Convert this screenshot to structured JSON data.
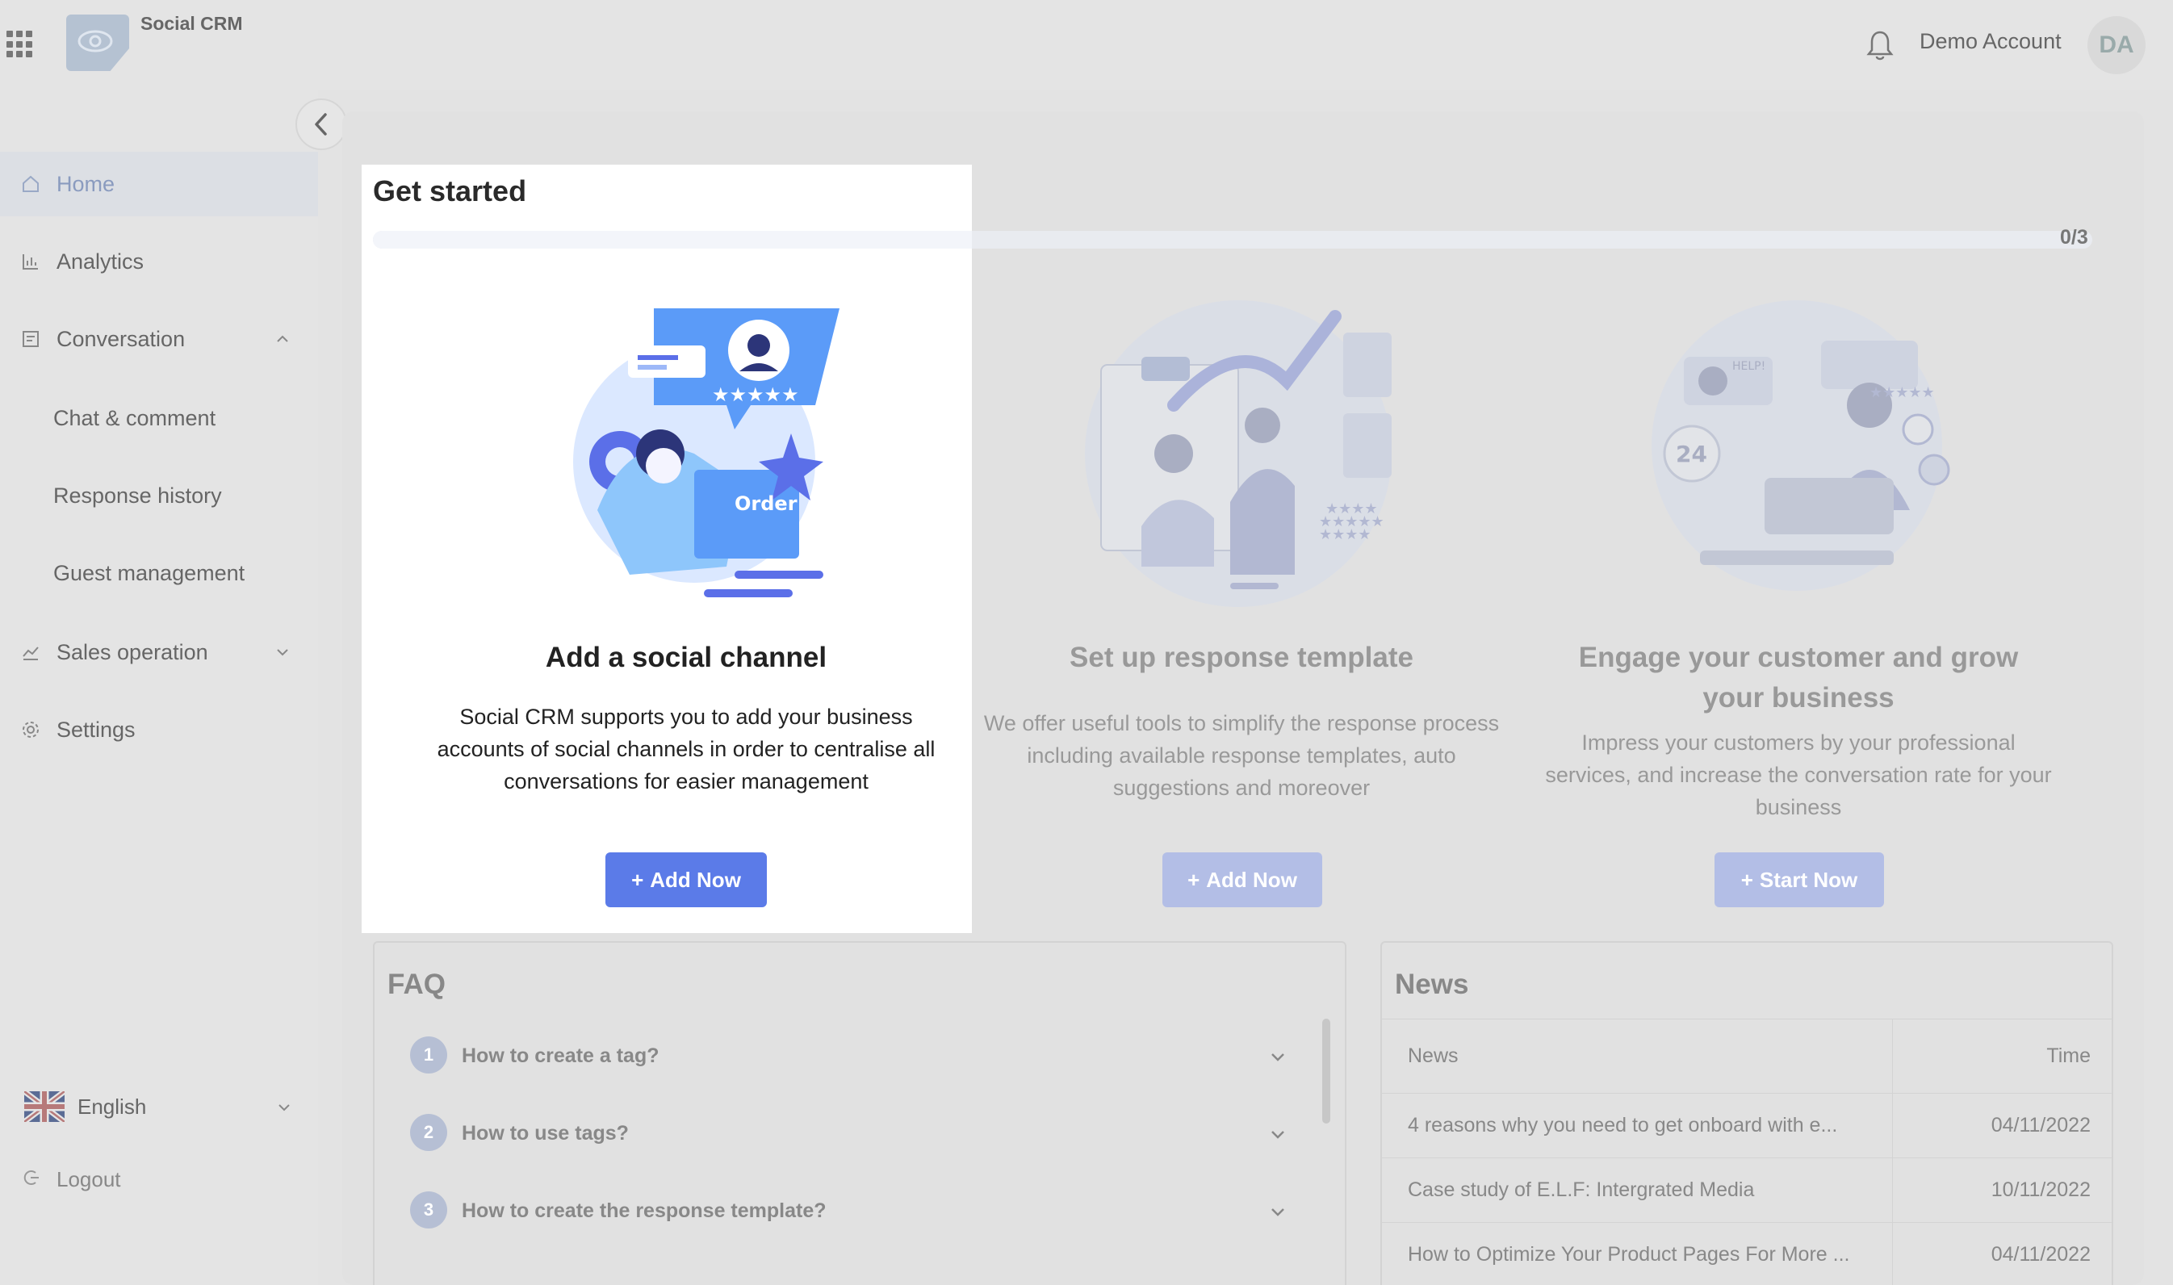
{
  "app": {
    "title": "Social CRM"
  },
  "header": {
    "account_name": "Demo Account",
    "avatar_initials": "DA"
  },
  "sidebar": {
    "items": [
      {
        "label": "Home"
      },
      {
        "label": "Analytics"
      },
      {
        "label": "Conversation"
      },
      {
        "label": "Chat & comment"
      },
      {
        "label": "Response history"
      },
      {
        "label": "Guest management"
      },
      {
        "label": "Sales operation"
      },
      {
        "label": "Settings"
      }
    ],
    "language": "English",
    "logout": "Logout"
  },
  "get_started": {
    "title": "Get started",
    "progress": "0/3",
    "progress_fraction": 0,
    "cards": [
      {
        "title": "Add a social channel",
        "description": "Social CRM supports you to add your business accounts of social channels in order to centralise all conversations for easier management",
        "button": "Add Now",
        "illustration_badge": "Order"
      },
      {
        "title": "Set up response template",
        "description": "We offer useful tools to simplify the response process including available response templates, auto suggestions and moreover",
        "button": "Add Now"
      },
      {
        "title": "Engage your customer and grow your business",
        "description": "Impress your customers by your professional services, and increase the conversation rate for your business",
        "button": "Start Now",
        "illustration_badges": [
          "HELP!",
          "24"
        ]
      }
    ]
  },
  "faq": {
    "title": "FAQ",
    "items": [
      {
        "num": "1",
        "question": "How to create a tag?"
      },
      {
        "num": "2",
        "question": "How to use tags?"
      },
      {
        "num": "3",
        "question": "How to create the response template?"
      }
    ]
  },
  "news": {
    "title": "News",
    "columns": [
      "News",
      "Time"
    ],
    "rows": [
      {
        "title": "4 reasons why you need to get onboard with e...",
        "time": "04/11/2022"
      },
      {
        "title": "Case study of E.L.F: Intergrated Media",
        "time": "10/11/2022"
      },
      {
        "title": "How to Optimize Your Product Pages For More ...",
        "time": "04/11/2022"
      }
    ]
  },
  "colors": {
    "accent": "#5b7be8",
    "accent_muted": "#b3bee6",
    "highlight": "#ffffff"
  }
}
